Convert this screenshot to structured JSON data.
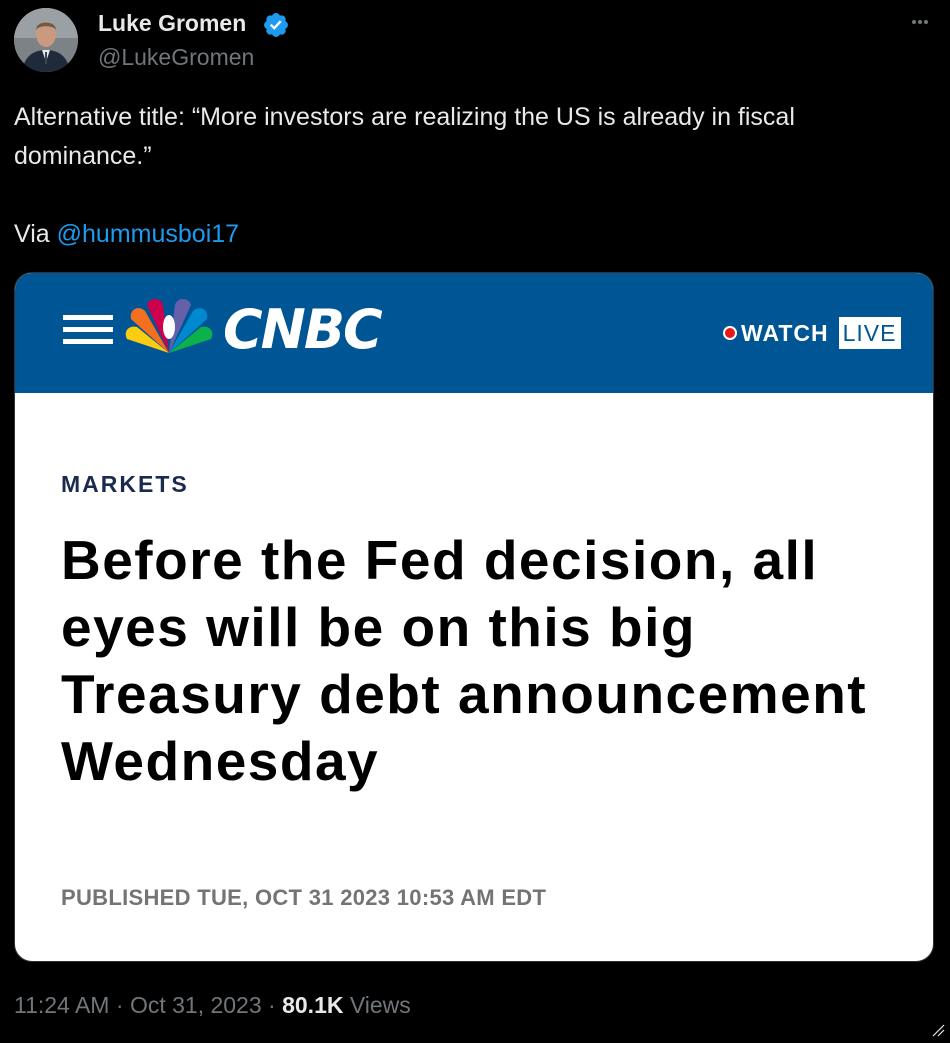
{
  "author": {
    "name": "Luke Gromen",
    "handle": "@LukeGromen",
    "verified_icon": "verified-badge-icon",
    "verified_color": "#1d9bf0"
  },
  "tweet": {
    "text_line1": "Alternative title: “More investors are realizing the US is already in fiscal dominance.”",
    "via_prefix": "Via ",
    "via_mention": "@hummusboi17",
    "mention_color": "#1d9bf0"
  },
  "card": {
    "brand": "CNBC",
    "header_color": "#005594",
    "watch_label": "WATCH",
    "live_label": "LIVE",
    "section": "MARKETS",
    "headline": "Before the Fed decision, all eyes will be on this big Treasury debt announcement Wednesday",
    "published": "PUBLISHED TUE, OCT 31 2023 10:53 AM EDT"
  },
  "meta": {
    "time": "11:24 AM",
    "separator": "·",
    "date": "Oct 31, 2023",
    "views_count": "80.1K",
    "views_label": "Views"
  },
  "icons": {
    "more": "more-options-icon",
    "menu": "hamburger-menu-icon",
    "logo": "nbc-peacock-logo",
    "live": "live-dot-icon"
  }
}
